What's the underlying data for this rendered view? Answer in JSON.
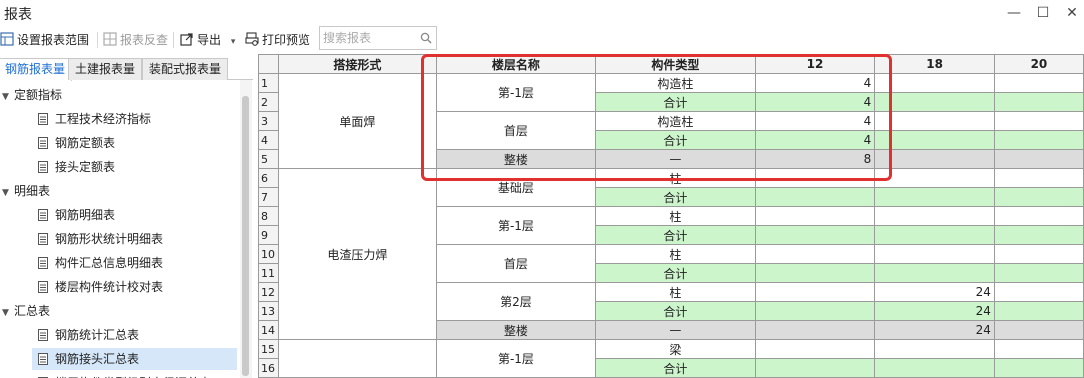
{
  "window": {
    "title": "报表",
    "minimize": "—",
    "maximize": "☐",
    "close": "✕"
  },
  "toolbar": {
    "set_range": "设置报表范围",
    "report_check": "报表反查",
    "export": "导出",
    "export_caret": "▾",
    "print_preview": "打印预览",
    "search_placeholder": "搜索报表"
  },
  "tabs": [
    {
      "label": "钢筋报表量",
      "active": true
    },
    {
      "label": "土建报表量",
      "active": false
    },
    {
      "label": "装配式报表量",
      "active": false
    }
  ],
  "tree": {
    "groups": [
      {
        "label": "定额指标",
        "items": [
          "工程技术经济指标",
          "钢筋定额表",
          "接头定额表"
        ]
      },
      {
        "label": "明细表",
        "items": [
          "钢筋明细表",
          "钢筋形状统计明细表",
          "构件汇总信息明细表",
          "楼层构件统计校对表"
        ]
      },
      {
        "label": "汇总表",
        "items": [
          "钢筋统计汇总表",
          "钢筋接头汇总表",
          "楼层构件类型级别直径汇总表"
        ]
      }
    ],
    "selected": "钢筋接头汇总表"
  },
  "grid": {
    "headers": [
      "搭接形式",
      "楼层名称",
      "构件类型",
      "12",
      "18",
      "20"
    ],
    "groups": [
      {
        "type": "单面焊",
        "floors": [
          {
            "name": "第-1层",
            "rows": [
              {
                "comp": "构造柱",
                "v12": "4",
                "v18": ""
              },
              {
                "comp": "合计",
                "v12": "4",
                "v18": "",
                "sub": true
              }
            ]
          },
          {
            "name": "首层",
            "rows": [
              {
                "comp": "构造柱",
                "v12": "4",
                "v18": ""
              },
              {
                "comp": "合计",
                "v12": "4",
                "v18": "",
                "sub": true
              }
            ]
          },
          {
            "name": "整楼",
            "rows": [
              {
                "comp": "—",
                "v12": "8",
                "v18": "",
                "total": true
              }
            ]
          }
        ]
      },
      {
        "type": "电渣压力焊",
        "floors": [
          {
            "name": "基础层",
            "rows": [
              {
                "comp": "柱",
                "v12": "",
                "v18": ""
              },
              {
                "comp": "合计",
                "v12": "",
                "v18": "",
                "sub": true
              }
            ]
          },
          {
            "name": "第-1层",
            "rows": [
              {
                "comp": "柱",
                "v12": "",
                "v18": ""
              },
              {
                "comp": "合计",
                "v12": "",
                "v18": "",
                "sub": true
              }
            ]
          },
          {
            "name": "首层",
            "rows": [
              {
                "comp": "柱",
                "v12": "",
                "v18": ""
              },
              {
                "comp": "合计",
                "v12": "",
                "v18": "",
                "sub": true
              }
            ]
          },
          {
            "name": "第2层",
            "rows": [
              {
                "comp": "柱",
                "v12": "",
                "v18": "24"
              },
              {
                "comp": "合计",
                "v12": "",
                "v18": "24",
                "sub": true
              }
            ]
          },
          {
            "name": "整楼",
            "rows": [
              {
                "comp": "—",
                "v12": "",
                "v18": "24",
                "total": true
              }
            ]
          }
        ]
      },
      {
        "type": "",
        "floors": [
          {
            "name": "第-1层",
            "rows": [
              {
                "comp": "梁",
                "v12": "",
                "v18": ""
              },
              {
                "comp": "合计",
                "v12": "",
                "v18": "",
                "sub": true
              }
            ]
          }
        ]
      }
    ]
  }
}
